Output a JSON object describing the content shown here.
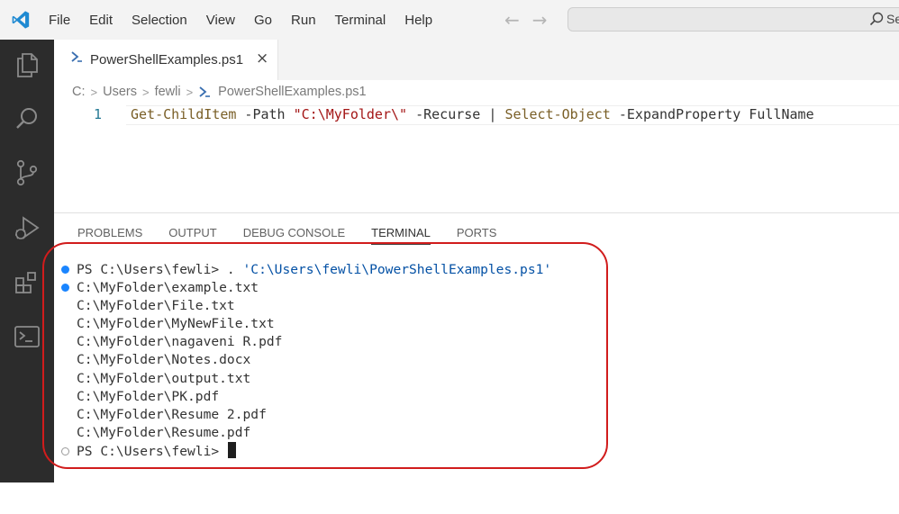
{
  "menu": [
    "File",
    "Edit",
    "Selection",
    "View",
    "Go",
    "Run",
    "Terminal",
    "Help"
  ],
  "search": {
    "text": "Se"
  },
  "tab": {
    "filename": "PowerShellExamples.ps1",
    "close": "×"
  },
  "breadcrumb": [
    "C:",
    "Users",
    "fewli",
    "PowerShellExamples.ps1"
  ],
  "editor": {
    "line_number": "1",
    "tokens": {
      "cmd1": "Get-ChildItem",
      "param1": " -Path ",
      "str1": "\"C:\\MyFolder\\\"",
      "param2": " -Recurse ",
      "pipe": "| ",
      "cmd2": "Select-Object",
      "param3": " -ExpandProperty FullName"
    }
  },
  "panel": {
    "tabs": [
      "PROBLEMS",
      "OUTPUT",
      "DEBUG CONSOLE",
      "TERMINAL",
      "PORTS"
    ],
    "active_tab": "TERMINAL"
  },
  "terminal": {
    "prompt1": "PS C:\\Users\\fewli> . ",
    "command": "'C:\\Users\\fewli\\PowerShellExamples.ps1'",
    "output": [
      "C:\\MyFolder\\example.txt",
      "C:\\MyFolder\\File.txt",
      "C:\\MyFolder\\MyNewFile.txt",
      "C:\\MyFolder\\nagaveni R.pdf",
      "C:\\MyFolder\\Notes.docx",
      "C:\\MyFolder\\output.txt",
      "C:\\MyFolder\\PK.pdf",
      "C:\\MyFolder\\Resume 2.pdf",
      "C:\\MyFolder\\Resume.pdf"
    ],
    "prompt2": "PS C:\\Users\\fewli> "
  },
  "colors": {
    "accent": "#007acc",
    "activitybar": "#2c2c2c",
    "highlight_ring": "#d11c1c"
  }
}
